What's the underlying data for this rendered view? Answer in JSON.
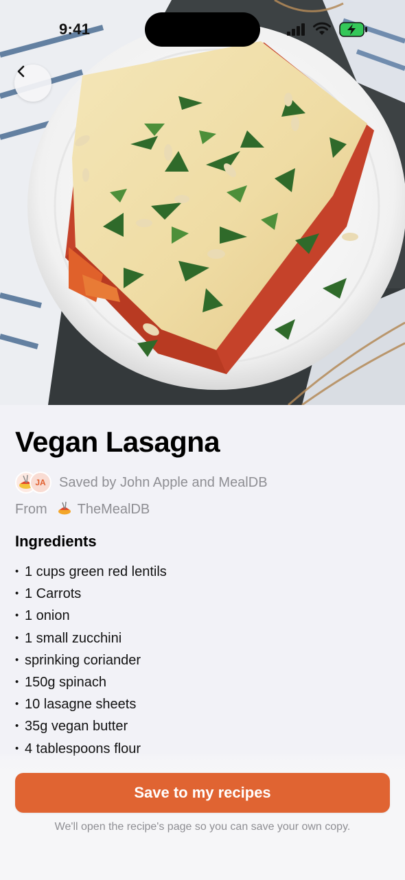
{
  "status_bar": {
    "time": "9:41"
  },
  "navigation": {
    "back_icon": "chevron-left-icon"
  },
  "hero": {
    "image_subject": "vegan-lasagna-photo"
  },
  "recipe": {
    "title": "Vegan Lasagna",
    "saved_by_text": "Saved by John Apple and MealDB",
    "avatar_initials": "JA",
    "from_label": "From",
    "source_name": "TheMealDB",
    "source_icon": "spaghetti-icon"
  },
  "ingredients": {
    "heading": "Ingredients",
    "items": [
      "1 cups green red lentils",
      "1 Carrots",
      "1 onion",
      "1 small zucchini",
      "sprinking coriander",
      "150g spinach",
      "10 lasagne sheets",
      "35g vegan butter",
      "4 tablespoons flour"
    ]
  },
  "actions": {
    "save_label": "Save to my recipes",
    "hint": "We'll open the recipe's page so you can save your own copy."
  },
  "colors": {
    "accent": "#e06432",
    "secondary_text": "#8e8e93",
    "background": "#f2f2f7",
    "battery_charging": "#34c759"
  }
}
